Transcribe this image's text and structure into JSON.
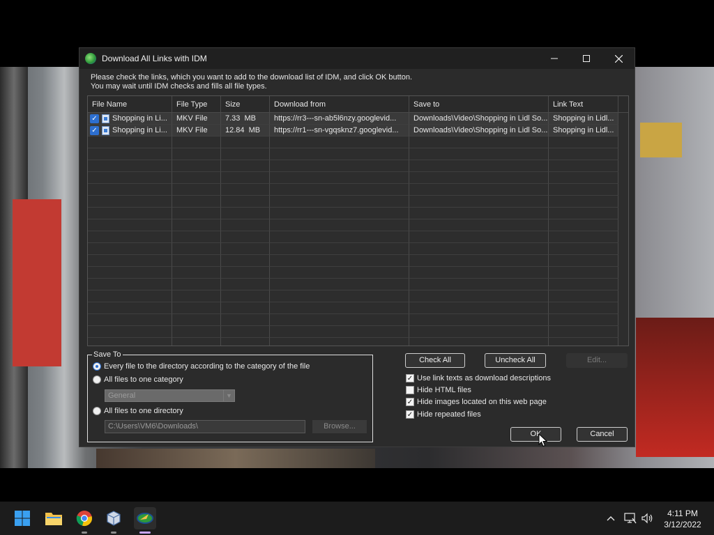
{
  "dialog": {
    "title": "Download All Links with IDM",
    "instructions_line1": "Please check the links, which you want to add to the download list of IDM, and click OK button.",
    "instructions_line2": "You may wait until IDM checks and fills all file types."
  },
  "table": {
    "columns": [
      "File Name",
      "File Type",
      "Size",
      "Download from",
      "Save to",
      "Link Text"
    ],
    "rows": [
      {
        "checked": true,
        "file_name": "Shopping in Li...",
        "file_type": "MKV File",
        "size": "7.33  MB",
        "download_from": "https://rr3---sn-ab5l6nzy.googlevid...",
        "save_to": "Downloads\\Video\\Shopping in Lidl So...",
        "link_text": "Shopping in Lidl..."
      },
      {
        "checked": true,
        "file_name": "Shopping in Li...",
        "file_type": "MKV File",
        "size": "12.84  MB",
        "download_from": "https://rr1---sn-vgqsknz7.googlevid...",
        "save_to": "Downloads\\Video\\Shopping in Lidl So...",
        "link_text": "Shopping in Lidl..."
      }
    ]
  },
  "save_to": {
    "legend": "Save To",
    "option_category_dir": "Every file to the directory according to the category of the file",
    "option_one_category": "All files to one category",
    "category_value": "General",
    "option_one_directory": "All files to one directory",
    "directory_value": "C:\\Users\\VM6\\Downloads\\",
    "browse_label": "Browse...",
    "selected": "category_dir"
  },
  "buttons": {
    "check_all": "Check All",
    "uncheck_all": "Uncheck All",
    "edit": "Edit...",
    "ok": "OK",
    "cancel": "Cancel"
  },
  "options": {
    "use_link_texts": {
      "label": "Use link texts as download descriptions",
      "checked": true
    },
    "hide_html": {
      "label": "Hide HTML files",
      "checked": false
    },
    "hide_images": {
      "label": "Hide images located on this web page",
      "checked": true
    },
    "hide_repeated": {
      "label": "Hide repeated files",
      "checked": true
    }
  },
  "taskbar": {
    "apps": [
      "windows-start-icon",
      "file-explorer-icon",
      "chrome-icon",
      "virtualbox-icon",
      "idm-icon"
    ],
    "time": "4:11 PM",
    "date": "3/12/2022"
  },
  "colors": {
    "accent": "#2d6fd0",
    "dialog_bg": "#2b2b2b",
    "taskbar_bg": "#1c1c1c"
  }
}
